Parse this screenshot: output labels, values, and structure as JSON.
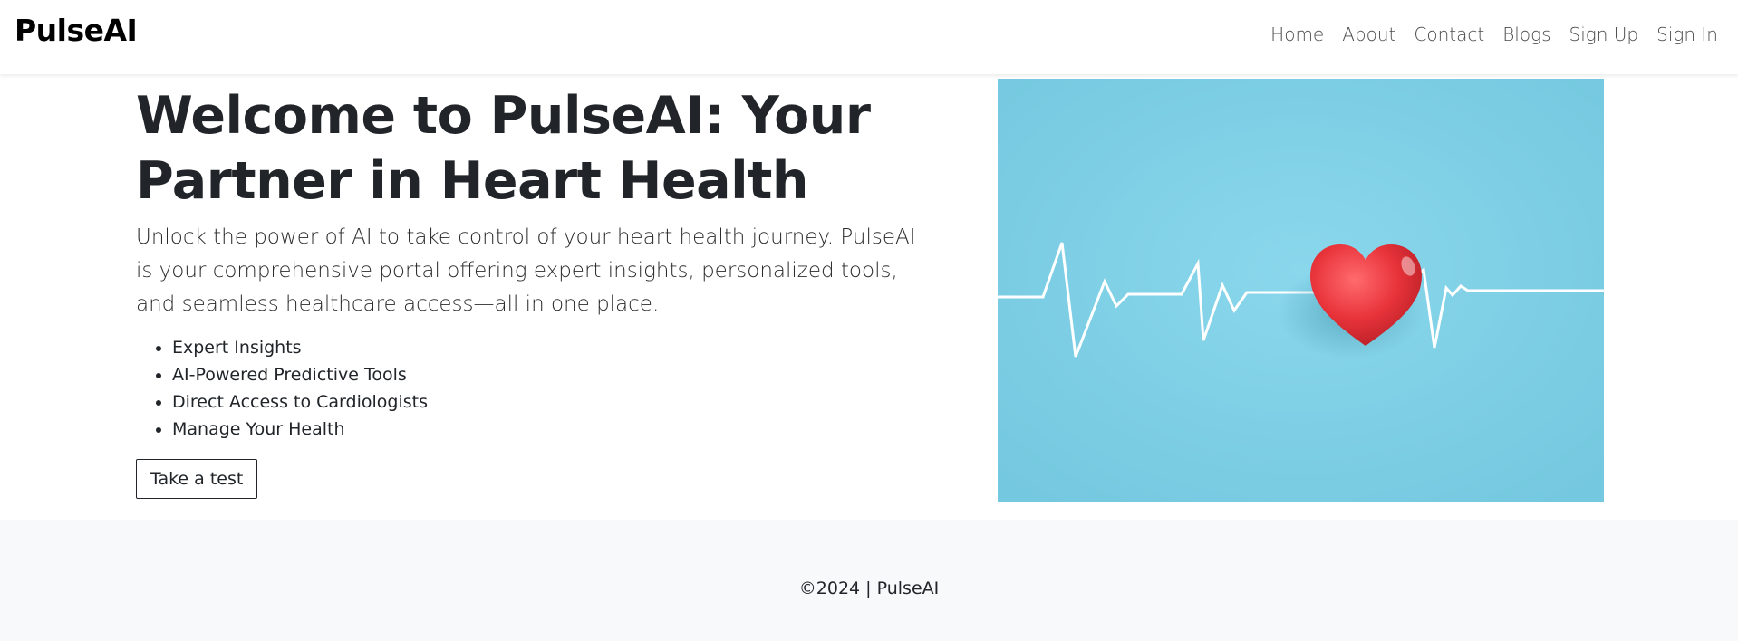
{
  "brand": "PulseAI",
  "nav": {
    "items": [
      {
        "label": "Home"
      },
      {
        "label": "About"
      },
      {
        "label": "Contact"
      },
      {
        "label": "Blogs"
      },
      {
        "label": "Sign Up"
      },
      {
        "label": "Sign In"
      }
    ]
  },
  "hero": {
    "title": "Welcome to PulseAI: Your Partner in Heart Health",
    "lead": "Unlock the power of AI to take control of your heart health journey. PulseAI is your comprehensive portal offering expert insights, personalized tools, and seamless healthcare access—all in one place.",
    "features": [
      "Expert Insights",
      "AI-Powered Predictive Tools",
      "Direct Access to Cardiologists",
      "Manage Your Health"
    ],
    "button_label": "Take a test",
    "image_icon": "heart-heartbeat-image"
  },
  "footer": {
    "text": "©2024 | PulseAI"
  },
  "colors": {
    "image_background": "#7fd0e6",
    "heart": "#e8333a",
    "footer_background": "#f8f9fa"
  }
}
